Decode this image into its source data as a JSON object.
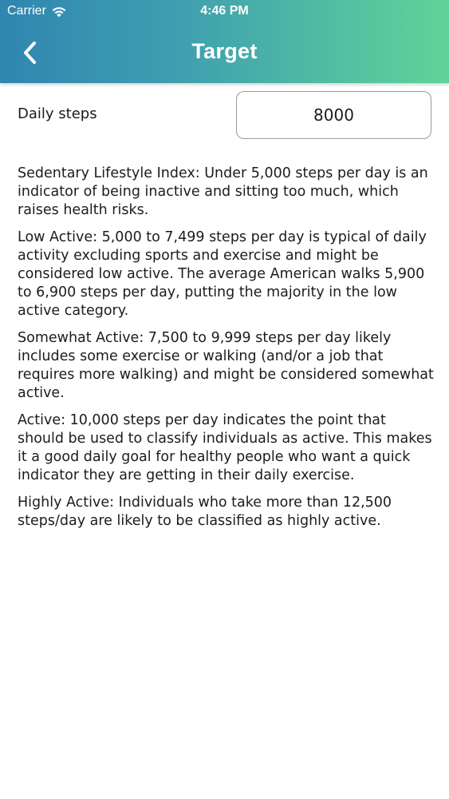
{
  "status_bar": {
    "carrier": "Carrier",
    "time": "4:46 PM",
    "wifi_icon": "wifi-icon"
  },
  "nav": {
    "back_icon": "chevron-left-icon",
    "title": "Target"
  },
  "form": {
    "steps_label": "Daily steps",
    "steps_value": "8000"
  },
  "descriptions": [
    "Sedentary Lifestyle Index: Under 5,000 steps per day is an indicator of being inactive and sitting too much, which raises health risks.",
    "Low Active: 5,000 to 7,499 steps per day is typical of daily activity excluding sports and exercise and might be considered low active. The average American walks 5,900 to 6,900 steps per day, putting the majority in the low active category.",
    "Somewhat Active: 7,500 to 9,999 steps per day likely includes some exercise or walking (and/or a job that requires more walking) and might be considered somewhat active.",
    "Active: 10,000 steps per day indicates the point that should be used to classify individuals as active. This makes it a good daily goal for healthy people who want a quick indicator they are getting in their daily exercise.",
    "Highly Active: Individuals who take more than 12,500 steps/day are likely to be classified as highly active."
  ],
  "colors": {
    "header_gradient_start": "#2f86b0",
    "header_gradient_end": "#5fd39a",
    "text": "#1c1c1e",
    "input_border": "#9a9a9e"
  }
}
